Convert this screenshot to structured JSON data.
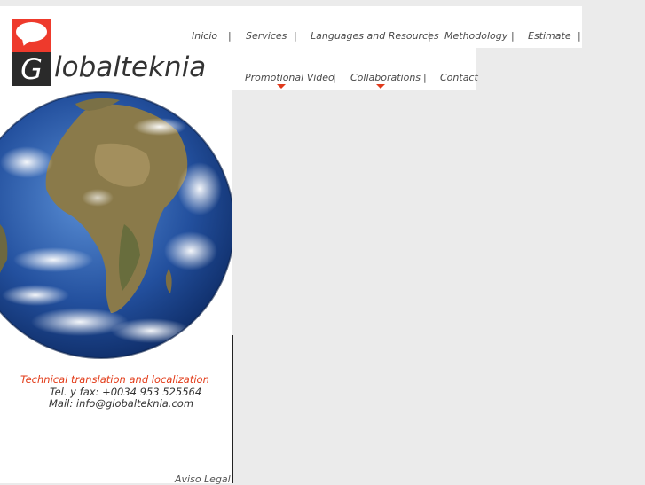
{
  "brand": {
    "name": "Globalteknia",
    "logo_letter": "G",
    "logo_rest": "lobalteknia",
    "bubble_color": "#ee3a2c"
  },
  "nav": {
    "row1": [
      "Inicio",
      "Services",
      "Languages and Resources",
      "Methodology",
      "Estimate"
    ],
    "row2": [
      "Promotional Video",
      "Collaborations",
      "Contact"
    ],
    "separator": "|"
  },
  "info": {
    "tagline": "Technical translation and localization",
    "phone": "Tel. y fax: +0034 953 525564",
    "mail": "Mail: info@globalteknia.com"
  },
  "footer": {
    "legal": "Aviso Legal"
  },
  "colors": {
    "accent": "#e23a17",
    "background": "#ebebeb"
  },
  "icons": {
    "globe": "earth-globe-image"
  }
}
